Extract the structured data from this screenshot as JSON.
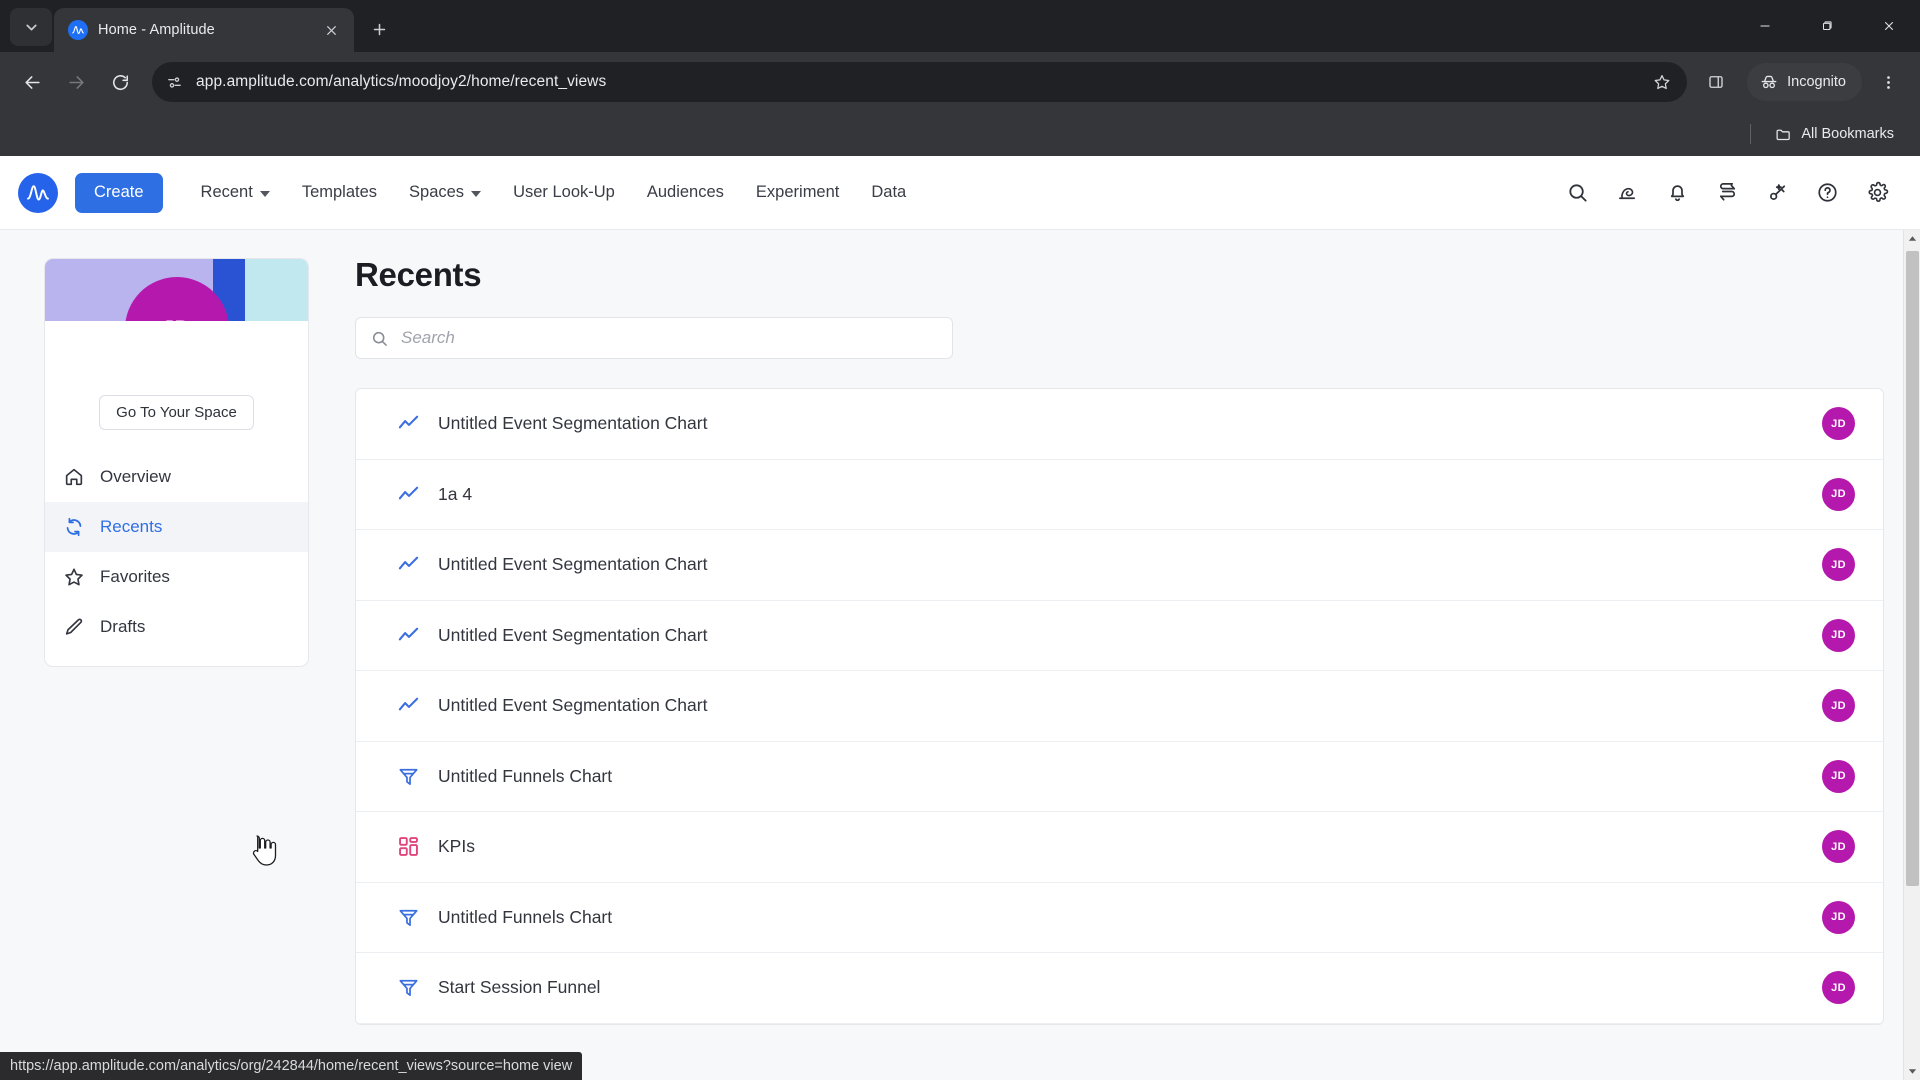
{
  "browser": {
    "tab": {
      "title": "Home - Amplitude",
      "favicon": "amplitude-icon"
    },
    "tablist_button": "tab-search-icon",
    "new_tab_button": "+",
    "window_controls": {
      "minimize": "minimize-icon",
      "maximize": "maximize-icon",
      "close": "close-icon"
    },
    "back": "back-arrow-icon",
    "forward": "forward-arrow-icon",
    "reload": "reload-icon",
    "site_info": "site-settings-icon",
    "url": "app.amplitude.com/analytics/moodjoy2/home/recent_views",
    "bookmark_star": "star-icon",
    "side_panel": "side-panel-icon",
    "incognito_label": "Incognito",
    "menu": "kebab-menu-icon",
    "all_bookmarks_label": "All Bookmarks"
  },
  "status_bar": {
    "url": "https://app.amplitude.com/analytics/org/242844/home/recent_views?source=home view"
  },
  "app_nav": {
    "logo": "amplitude-logo",
    "create_label": "Create",
    "items": [
      {
        "label": "Recent",
        "has_caret": true
      },
      {
        "label": "Templates",
        "has_caret": false
      },
      {
        "label": "Spaces",
        "has_caret": true
      },
      {
        "label": "User Look-Up",
        "has_caret": false
      },
      {
        "label": "Audiences",
        "has_caret": false
      },
      {
        "label": "Experiment",
        "has_caret": false
      },
      {
        "label": "Data",
        "has_caret": false
      }
    ],
    "right_icons": [
      {
        "name": "search-icon"
      },
      {
        "name": "whats-new-icon"
      },
      {
        "name": "notifications-bell-icon"
      },
      {
        "name": "compare-swap-icon"
      },
      {
        "name": "ai-sparkle-key-icon"
      },
      {
        "name": "help-circle-icon"
      },
      {
        "name": "settings-gear-icon"
      }
    ]
  },
  "sidebar": {
    "avatar_initials": "JD",
    "go_to_space_label": "Go To Your Space",
    "banner_colors": {
      "lavender": "#b9b3ee",
      "blue": "#2a53d4",
      "cyan": "#c1e8ef",
      "avatar": "#b518ad"
    },
    "items": [
      {
        "label": "Overview",
        "icon": "home-icon",
        "active": false
      },
      {
        "label": "Recents",
        "icon": "refresh-cycle-icon",
        "active": true
      },
      {
        "label": "Favorites",
        "icon": "star-icon",
        "active": false
      },
      {
        "label": "Drafts",
        "icon": "pencil-icon",
        "active": false
      }
    ]
  },
  "main": {
    "title": "Recents",
    "search": {
      "value": "",
      "placeholder": "Search",
      "icon": "search-icon"
    },
    "rows": [
      {
        "label": "Untitled Event Segmentation Chart",
        "icon": "line-chart-icon",
        "avatar": "JD"
      },
      {
        "label": "1a 4",
        "icon": "line-chart-icon",
        "avatar": "JD"
      },
      {
        "label": "Untitled Event Segmentation Chart",
        "icon": "line-chart-icon",
        "avatar": "JD"
      },
      {
        "label": "Untitled Event Segmentation Chart",
        "icon": "line-chart-icon",
        "avatar": "JD"
      },
      {
        "label": "Untitled Event Segmentation Chart",
        "icon": "line-chart-icon",
        "avatar": "JD"
      },
      {
        "label": "Untitled Funnels Chart",
        "icon": "funnel-icon",
        "avatar": "JD"
      },
      {
        "label": "KPIs",
        "icon": "kpi-grid-icon",
        "avatar": "JD"
      },
      {
        "label": "Untitled Funnels Chart",
        "icon": "funnel-icon",
        "avatar": "JD"
      },
      {
        "label": "Start Session Funnel",
        "icon": "funnel-icon",
        "avatar": "JD"
      }
    ]
  },
  "colors": {
    "accent_blue": "#2f6fe4",
    "chart_icon_blue": "#3b6fe0",
    "kpi_pink": "#e0457b",
    "avatar_magenta": "#b518ad"
  }
}
